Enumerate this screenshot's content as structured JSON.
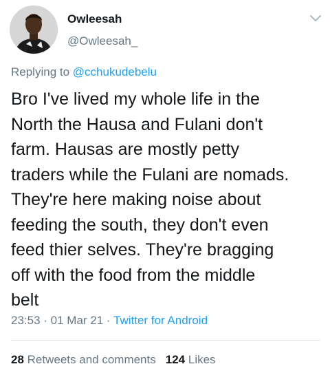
{
  "author": {
    "display_name": "Owleesah",
    "handle": "@Owleesah_"
  },
  "reply": {
    "prefix": "Replying to",
    "mention": "@cchukudebelu"
  },
  "tweet_lines": [
    "Bro I've lived my whole life in the",
    "North the Hausa and Fulani don't",
    "farm. Hausas are mostly petty",
    "traders while the Fulani are nomads.",
    "They're here making noise about",
    "feeding the south, they don't even",
    "feed thier selves. They're bragging",
    "off with the food from the middle",
    "belt"
  ],
  "meta": {
    "time": "23:53",
    "separator": " · ",
    "date": "01 Mar 21",
    "source": "Twitter for Android"
  },
  "stats": {
    "retweets_count": "28",
    "retweets_label": "Retweets and comments",
    "likes_count": "124",
    "likes_label": "Likes"
  },
  "icons": {
    "more_menu": "chevron-down-icon"
  },
  "colors": {
    "link": "#1da1f2",
    "secondary_text": "#657786",
    "primary_text": "#14171a"
  }
}
